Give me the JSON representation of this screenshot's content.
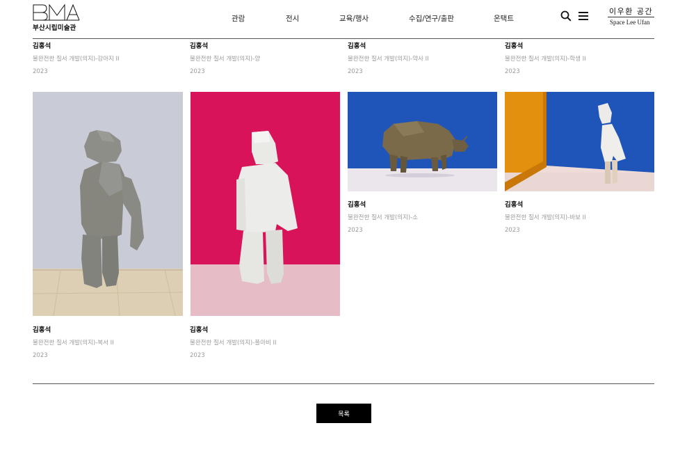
{
  "header": {
    "logo": {
      "mark": "BMA",
      "text": "부산시립미술관"
    },
    "nav": [
      "관람",
      "전시",
      "교육/행사",
      "수집/연구/출판",
      "온택트"
    ],
    "space": {
      "kr": "이우환 공간",
      "en": "Space Lee Ufan"
    }
  },
  "top_row": [
    {
      "artist": "김홍석",
      "title": "불완전한 질서 개발(의지)-강아지 II",
      "year": "2023"
    },
    {
      "artist": "김홍석",
      "title": "불완전한 질서 개발(의지)-양",
      "year": "2023"
    },
    {
      "artist": "김홍석",
      "title": "불완전한 질서 개발(의지)-약사 II",
      "year": "2023"
    },
    {
      "artist": "김홍석",
      "title": "불완전한 질서 개발(의지)-학생 II",
      "year": "2023"
    }
  ],
  "artworks": [
    {
      "artist": "김홍석",
      "title": "불완전한 질서 개발(의지)-복서 II",
      "year": "2023",
      "image": "gray-figure-on-wood-floor",
      "background": "#c9ccd6"
    },
    {
      "artist": "김홍석",
      "title": "불완전한 질서 개발(의지)-풀아비 II",
      "year": "2023",
      "image": "white-figure-on-magenta",
      "background": "#d8135a"
    },
    {
      "artist": "김홍석",
      "title": "불완전한 질서 개발(의지)-소",
      "year": "2023",
      "image": "brown-cow-on-blue",
      "background": "#1f55b8"
    },
    {
      "artist": "김홍석",
      "title": "불완전한 질서 개발(의지)-바보 II",
      "year": "2023",
      "image": "white-figure-on-orange-blue",
      "background": "#e3900e"
    }
  ],
  "list_button": "목록"
}
